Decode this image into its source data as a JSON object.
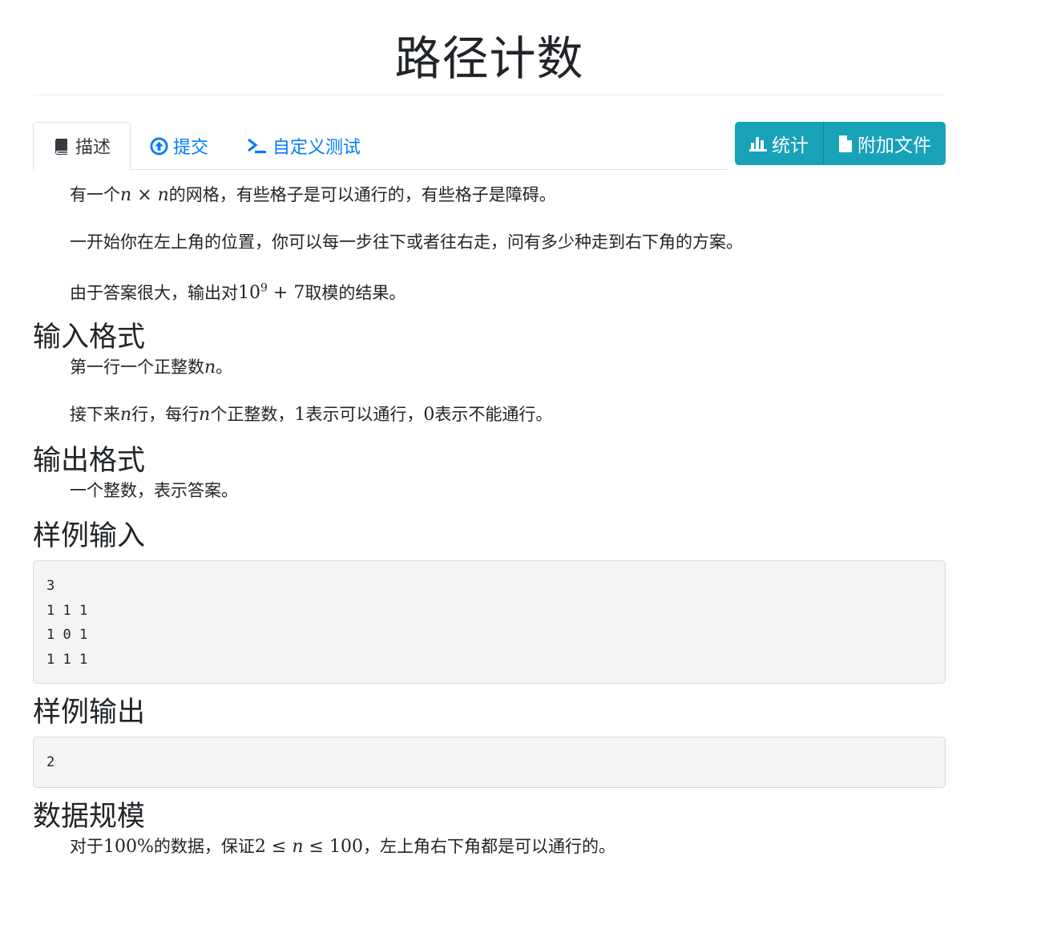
{
  "problem": {
    "title": "路径计数"
  },
  "tabs": [
    {
      "label": "描述",
      "icon": "book-icon",
      "active": true
    },
    {
      "label": "提交",
      "icon": "arrow-circle-up-icon",
      "active": false
    },
    {
      "label": "自定义测试",
      "icon": "terminal-icon",
      "active": false
    }
  ],
  "actions": {
    "stats_label": "统计",
    "stats_icon": "bar-chart-icon",
    "attachment_label": "附加文件",
    "attachment_icon": "file-icon"
  },
  "description": {
    "p1_before": "有一个",
    "p1_math": [
      "n",
      "×",
      "n"
    ],
    "p1_after": "的网格，有些格子是可以通行的，有些格子是障碍。",
    "p2": "一开始你在左上角的位置，你可以每一步往下或者往右走，问有多少种走到右下角的方案。",
    "p3_before": "由于答案很大，输出对",
    "p3_math_base": "10",
    "p3_math_exp": "9",
    "p3_math_rest": "+ 7",
    "p3_after": "取模的结果。"
  },
  "input_format": {
    "heading": "输入格式",
    "p1_before": "第一行一个正整数",
    "p1_var": "n",
    "p1_after": "。",
    "p2_a": "接下来",
    "p2_var1": "n",
    "p2_b": "行，每行",
    "p2_var2": "n",
    "p2_c": "个正整数，",
    "p2_num1": "1",
    "p2_d": "表示可以通行，",
    "p2_num2": "0",
    "p2_e": "表示不能通行。"
  },
  "output_format": {
    "heading": "输出格式",
    "p1": "一个整数，表示答案。"
  },
  "sample_input": {
    "heading": "样例输入",
    "content": "3\n1 1 1\n1 0 1\n1 1 1"
  },
  "sample_output": {
    "heading": "样例输出",
    "content": "2"
  },
  "constraints": {
    "heading": "数据规模",
    "before": "对于",
    "percent": "100%",
    "middle": "的数据，保证",
    "m_lo": "2",
    "m_le1": "≤",
    "m_var": "n",
    "m_le2": "≤",
    "m_hi": "100",
    "after": "，左上角右下角都是可以通行的。"
  }
}
